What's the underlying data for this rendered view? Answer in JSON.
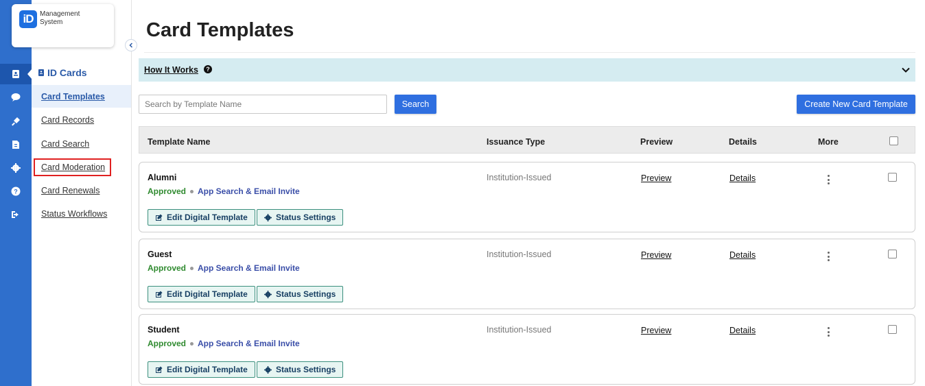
{
  "logo": {
    "badge": "iD",
    "line1": "Management",
    "line2": "System"
  },
  "rail": {
    "icons": [
      "id-card-icon",
      "chat-icon",
      "plug-icon",
      "document-icon",
      "gear-icon",
      "help-icon",
      "logout-icon"
    ]
  },
  "subnav": {
    "section_title": "ID Cards",
    "items": [
      {
        "label": "Card Templates"
      },
      {
        "label": "Card Records"
      },
      {
        "label": "Card Search"
      },
      {
        "label": "Card Moderation"
      },
      {
        "label": "Card Renewals"
      },
      {
        "label": "Status Workflows"
      }
    ]
  },
  "page": {
    "title": "Card Templates"
  },
  "how_it_works": {
    "label": "How It Works",
    "help_glyph": "?"
  },
  "toolbar": {
    "search_placeholder": "Search by Template Name",
    "search_label": "Search",
    "create_label": "Create New Card Template"
  },
  "table": {
    "headers": {
      "template_name": "Template Name",
      "issuance_type": "Issuance Type",
      "preview": "Preview",
      "details": "Details",
      "more": "More"
    },
    "rows": [
      {
        "name": "Alumni",
        "status": "Approved",
        "method": "App Search & Email Invite",
        "issuance": "Institution-Issued",
        "preview": "Preview",
        "details": "Details",
        "edit_label": "Edit Digital Template",
        "status_settings_label": "Status Settings"
      },
      {
        "name": "Guest",
        "status": "Approved",
        "method": "App Search & Email Invite",
        "issuance": "Institution-Issued",
        "preview": "Preview",
        "details": "Details",
        "edit_label": "Edit Digital Template",
        "status_settings_label": "Status Settings"
      },
      {
        "name": "Student",
        "status": "Approved",
        "method": "App Search & Email Invite",
        "issuance": "Institution-Issued",
        "preview": "Preview",
        "details": "Details",
        "edit_label": "Edit Digital Template",
        "status_settings_label": "Status Settings"
      }
    ]
  },
  "colors": {
    "rail": "#2f6fcc",
    "accent": "#2f6fe0",
    "how_bar": "#d5ecf1",
    "approved": "#2f8a2f",
    "highlight": "#e02020"
  }
}
